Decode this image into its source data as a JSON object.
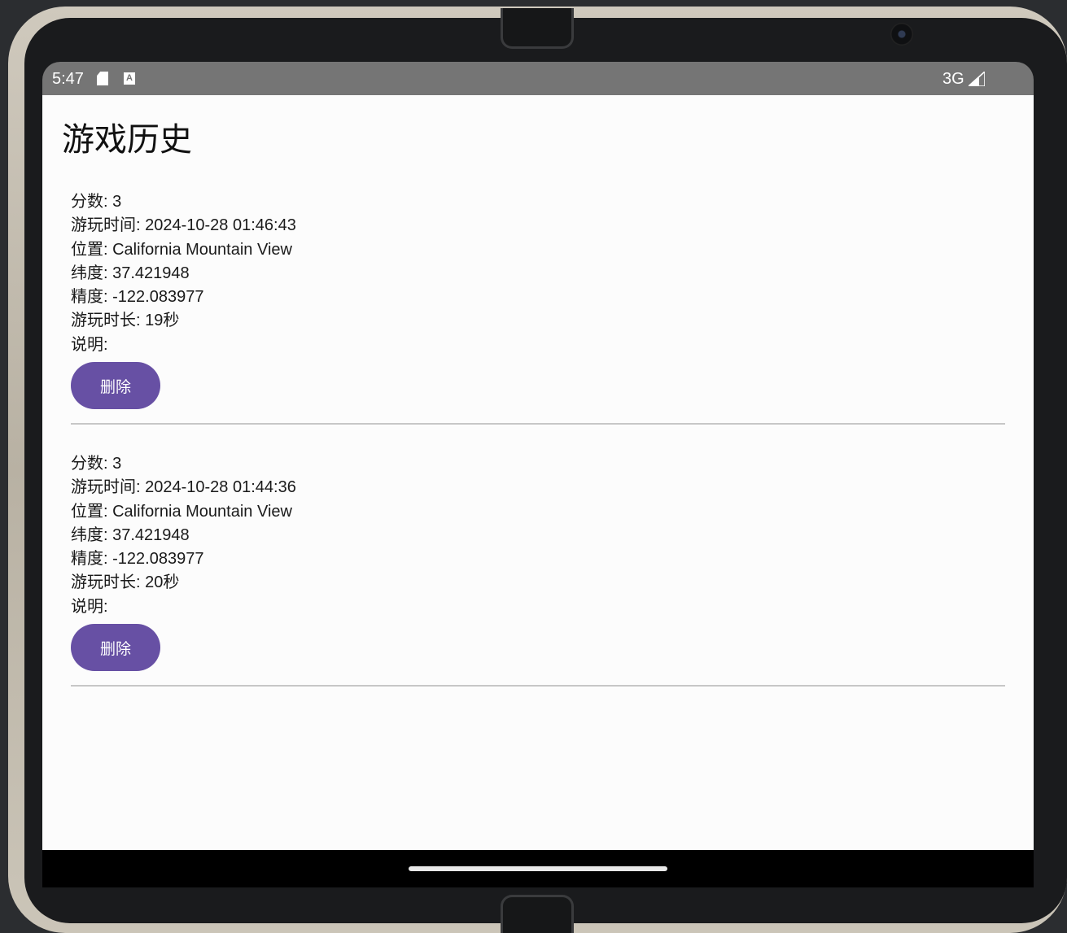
{
  "status_bar": {
    "time": "5:47",
    "a_icon_letter": "A",
    "network": "3G",
    "icons": [
      "sd-card-icon",
      "a-icon",
      "signal-icon"
    ]
  },
  "page": {
    "title": "游戏历史"
  },
  "records": [
    {
      "score": "分数: 3",
      "play_time": "游玩时间: 2024-10-28 01:46:43",
      "location": "位置: California Mountain View",
      "latitude": "纬度: 37.421948",
      "longitude": "精度: -122.083977",
      "duration": "游玩时长: 19秒",
      "notes": "说明:",
      "delete_label": "删除"
    },
    {
      "score": "分数: 3",
      "play_time": "游玩时间: 2024-10-28 01:44:36",
      "location": "位置: California Mountain View",
      "latitude": "纬度: 37.421948",
      "longitude": "精度: -122.083977",
      "duration": "游玩时长: 20秒",
      "notes": "说明:",
      "delete_label": "删除"
    }
  ],
  "colors": {
    "status_bar": "#757575",
    "accent_button": "#6750a4",
    "background": "#fcfcfc",
    "divider": "#c7c7c7"
  }
}
